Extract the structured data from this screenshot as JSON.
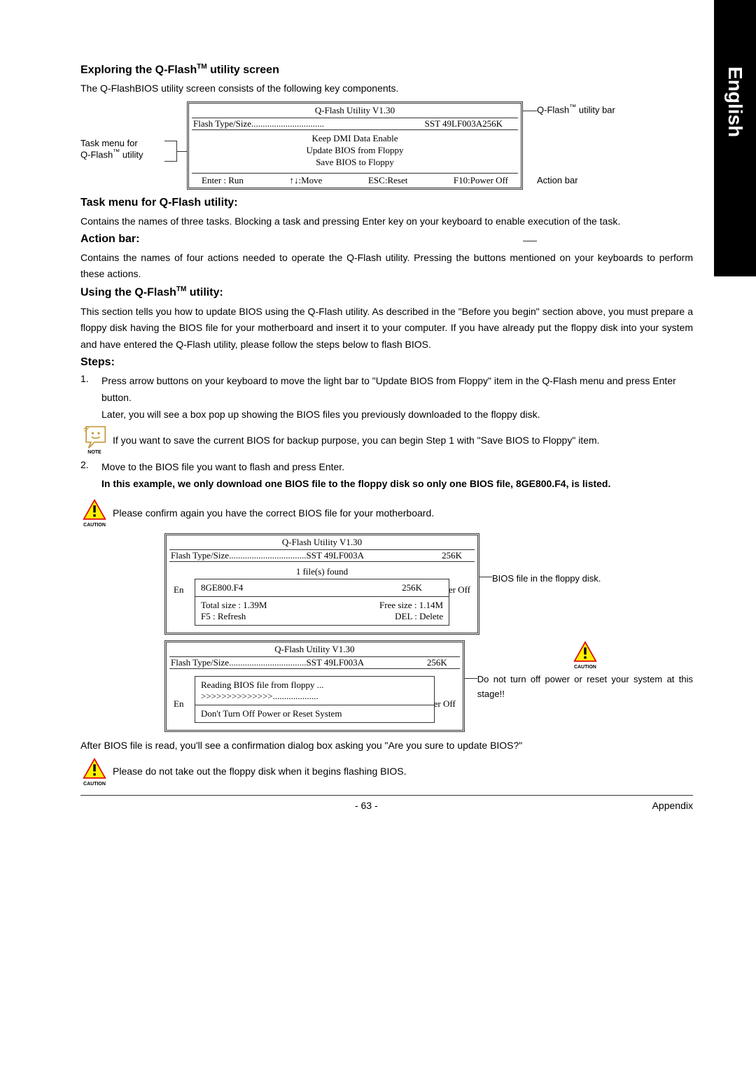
{
  "side_tab": "English",
  "h_explore": "Exploring the Q-Flash",
  "h_explore_suffix": " utility screen",
  "p_explore": "The Q-FlashBIOS utility screen consists of the following key components.",
  "diagram1": {
    "left_l1": "Task menu for",
    "left_l2": "Q-Flash",
    "left_l2_suffix": " utility",
    "r1": "Q-Flash",
    "r1_suffix": " utility bar",
    "r2": "Action bar"
  },
  "qflash1": {
    "title": "Q-Flash Utility V1.30",
    "flash_label": "Flash Type/Size",
    "flash_val": "SST 49LF003A",
    "flash_size": "256K",
    "menu1": "Keep DMI Data     Enable",
    "menu2": "Update BIOS from Floppy",
    "menu3": "Save BIOS to Floppy",
    "a1": "Enter : Run",
    "a2": "↑↓:Move",
    "a3": "ESC:Reset",
    "a4": "F10:Power Off"
  },
  "h_taskmenu": "Task menu for Q-Flash utility:",
  "p_taskmenu": "Contains the names of three tasks. Blocking a task and pressing Enter key on your keyboard to enable execution of the task.",
  "h_actionbar": "Action bar:",
  "p_actionbar": "Contains the names of four actions needed to operate the Q-Flash utility. Pressing the buttons mentioned on your keyboards to perform these actions.",
  "h_using": "Using the Q-Flash",
  "h_using_suffix": " utility:",
  "p_using": "This section tells you how to update BIOS using the Q-Flash utility. As described in the \"Before you begin\" section above, you must prepare a floppy disk having the BIOS file for your motherboard and insert it to your computer. If you have already put the floppy disk into your system and have entered the Q-Flash utility, please follow the steps below to flash BIOS.",
  "h_steps": "Steps:",
  "step1_num": "1.",
  "step1_a": "Press arrow buttons on your keyboard to move the light bar to \"Update BIOS from Floppy\" item in the Q-Flash menu and press Enter button.",
  "step1_b": "Later, you will see a box pop up showing the BIOS files you previously downloaded to the floppy disk.",
  "note1": "If you want to save the current BIOS for backup purpose, you can begin Step 1 with \"Save BIOS to Floppy\" item.",
  "note1_label": "NOTE",
  "step2_num": "2.",
  "step2_a": "Move to the BIOS file you want to flash and press Enter.",
  "step2_b": "In this example, we only download one BIOS file to the floppy disk so only one BIOS file, 8GE800.F4, is listed.",
  "caution1": "Please confirm again you have the correct BIOS file for your motherboard.",
  "caution_label": "CAUTION",
  "qflash2": {
    "title": "Q-Flash Utility V1.30",
    "flash_label": "Flash Type/Size",
    "flash_val": "SST 49LF003A",
    "flash_size": "256K",
    "files_found": "1 file(s) found",
    "file_name": "8GE800.F4",
    "file_size": "256K",
    "total": "Total size : 1.39M",
    "free": "Free size : 1.14M",
    "f5": "F5 : Refresh",
    "del": "DEL : Delete",
    "behind_left": "En",
    "behind_right": "er Off"
  },
  "d2_right1": "BIOS file in the floppy disk.",
  "qflash3": {
    "title": "Q-Flash Utility V1.30",
    "flash_label": "Flash Type/Size",
    "flash_val": "SST 49LF003A",
    "flash_size": "256K",
    "reading": "Reading BIOS file from floppy ...",
    "progress": ">>>>>>>>>>>>>>....................",
    "warn": "Don't Turn Off Power or Reset System",
    "behind_left": "En",
    "behind_right": "er Off"
  },
  "d3_right": "Do not turn off power or reset your system at this stage!!",
  "p_after": "After BIOS file is read, you'll see a confirmation dialog box asking you \"Are you sure to update BIOS?\"",
  "caution2": "Please do not take out the floppy disk when it begins flashing BIOS.",
  "footer_page": "- 63 -",
  "footer_right": "Appendix"
}
